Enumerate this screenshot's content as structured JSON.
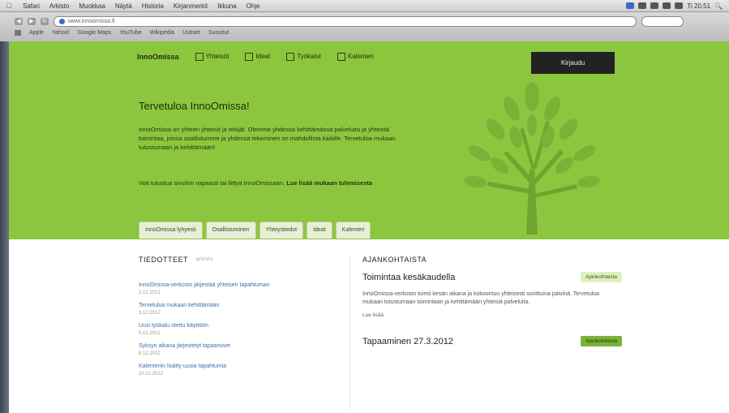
{
  "os_menu": {
    "items": [
      "Safari",
      "Arkisto",
      "Muokkaa",
      "Näytä",
      "Historia",
      "Kirjanmerkit",
      "Ikkuna",
      "Ohje"
    ],
    "clock": "Ti 20.51"
  },
  "browser": {
    "url": "www.innoomissa.fi",
    "bookmarks": [
      "Apple",
      "Yahoo!",
      "Google Maps",
      "YouTube",
      "Wikipedia",
      "Uutiset",
      "Suositut"
    ]
  },
  "site": {
    "logo": "InnoOmissa",
    "nav": [
      "Yhteisöt",
      "Ideat",
      "Työkalut",
      "Kalenteri"
    ],
    "login_label": "Kirjaudu",
    "hero_title": "Tervetuloa InnoOmissa!",
    "hero_paragraph": "InnoOmissa on yhteen yhteisö ja tekijät. Olemme yhdessä kehittämässä palveluita ja yhteistä toimintaa, joissa osallistumme ja yhdessä tekeminen on mahdollista kaikille. Tervetuloa mukaan tutustumaan ja kehittämään!",
    "hero_paragraph2_prefix": "Voit tutustua sivuihin vapaasti tai liittyä InnoOmissaan. ",
    "hero_paragraph2_strong": "Lue lisää mukaan tulemisesta",
    "tabs": [
      "InnoOmissa lyhyesti",
      "Osallistuminen",
      "Yhteystiedot",
      "Ideat",
      "Kalenteri"
    ]
  },
  "news": {
    "heading": "TIEDOTTEET",
    "subheading": "arkisto",
    "items": [
      {
        "title": "InnoOmissa-verkosto järjestää yhteisen tapahtuman",
        "date": "2.12.2012"
      },
      {
        "title": "Tervetuloa mukaan kehittämään",
        "date": "3.12.2012"
      },
      {
        "title": "Uusi työkalu otettu käyttöön",
        "date": "5.12.2012"
      },
      {
        "title": "Syksyn aikana järjestetyt tapaamiset",
        "date": "8.12.2012"
      },
      {
        "title": "Kalenteriin lisätty uusia tapahtumia",
        "date": "10.12.2012"
      }
    ]
  },
  "current": {
    "heading": "AJANKOHTAISTA",
    "article1": {
      "title": "Toimintaa kesäkaudella",
      "tag": "Ajankohtaista",
      "body": "InnoOmissa-verkosto toimii kesän aikana ja kokoontuu yhteisesti sovittuina päivinä. Tervetuloa mukaan tutustumaan toimintaan ja kehittämään yhteisiä palveluita.",
      "readmore": "Lue lisää"
    },
    "article2": {
      "title": "Tapaaminen 27.3.2012",
      "tag": "Ajankohtaista"
    }
  }
}
